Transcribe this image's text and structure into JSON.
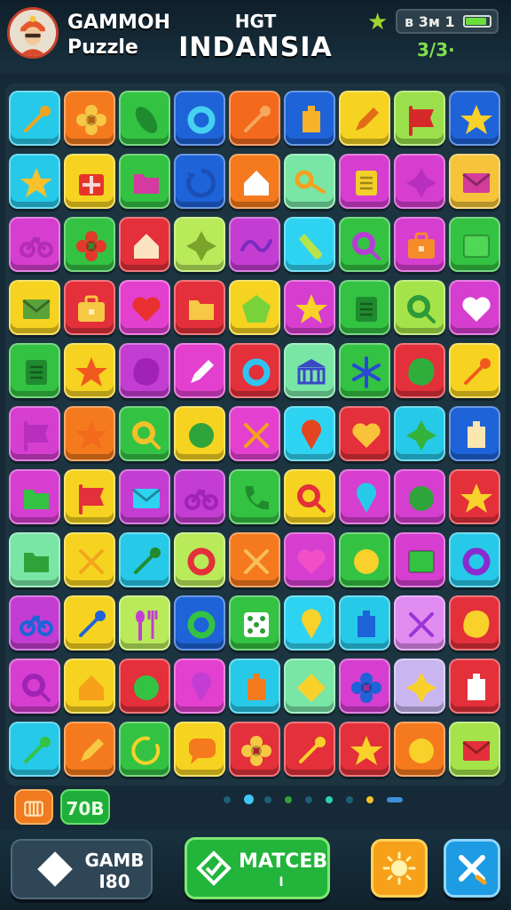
{
  "header": {
    "app_title_line1": "GAMMOH",
    "app_title_line2": "Puzzle",
    "level_label": "HGT",
    "level_name": "INDANSIA",
    "status_text": "ʙ 3ᴍ 1",
    "battery_level": 0.9,
    "score": "3/3·",
    "star_icon": "star-icon"
  },
  "board": {
    "rows": 11,
    "cols": 9,
    "tiles": [
      [
        "#27c9e8",
        "wrench",
        "#f2a51c"
      ],
      [
        "#f47a1d",
        "flower",
        "#f7c843"
      ],
      [
        "#34c243",
        "pickle",
        "#1f8b2e"
      ],
      [
        "#1e63d8",
        "ring",
        "#45d1f0"
      ],
      [
        "#f36a1c",
        "wrench",
        "#f5a75d"
      ],
      [
        "#1e63d8",
        "tag",
        "#f7b22a"
      ],
      [
        "#f6d320",
        "pencil",
        "#e36c18"
      ],
      [
        "#9be04c",
        "flag",
        "#d62a2a"
      ],
      [
        "#1e63d8",
        "star",
        "#f8d12a"
      ],
      [
        "#27c9e8",
        "star",
        "#f7c12b"
      ],
      [
        "#f6d320",
        "gift",
        "#e6342b"
      ],
      [
        "#34c243",
        "folder",
        "#d43aa0"
      ],
      [
        "#1e63d8",
        "cycle",
        "#1b4fb6"
      ],
      [
        "#f47a1d",
        "house",
        "#ffffff"
      ],
      [
        "#79e6a6",
        "key",
        "#f3a11f"
      ],
      [
        "#d63ed0",
        "list",
        "#f3cf2a"
      ],
      [
        "#d63ed0",
        "star4",
        "#b82fc0"
      ],
      [
        "#f6c43a",
        "envelope",
        "#d33c9b"
      ],
      [
        "#d63ed0",
        "bike",
        "#b22db4"
      ],
      [
        "#34c243",
        "flower",
        "#e13a2a"
      ],
      [
        "#e3303a",
        "house",
        "#fce4c2"
      ],
      [
        "#b8ea5a",
        "star4",
        "#7aa42a"
      ],
      [
        "#c43dd2",
        "wave",
        "#7a2bc0"
      ],
      [
        "#2fd3f2",
        "drop",
        "#b9e34a"
      ],
      [
        "#34c243",
        "search",
        "#b73bd6"
      ],
      [
        "#d63ed0",
        "case",
        "#f58c2a"
      ],
      [
        "#34c243",
        "rect",
        "#4fd755"
      ],
      [
        "#f6d320",
        "envelope",
        "#5aa33a"
      ],
      [
        "#e3303a",
        "case",
        "#f7c843"
      ],
      [
        "#e340d0",
        "heart",
        "#e83030"
      ],
      [
        "#e3303a",
        "folder",
        "#f7c843"
      ],
      [
        "#f6d320",
        "pentagon",
        "#7ad33a"
      ],
      [
        "#d63ed0",
        "star",
        "#f8d12a"
      ],
      [
        "#34c243",
        "list",
        "#1f8b2e"
      ],
      [
        "#a5e34a",
        "search",
        "#2f9a39"
      ],
      [
        "#d63ed0",
        "heart",
        "#ffffff"
      ],
      [
        "#34c243",
        "list",
        "#1f8b2e"
      ],
      [
        "#f6d320",
        "star",
        "#f05a1f"
      ],
      [
        "#c43dd2",
        "blob",
        "#a023b5"
      ],
      [
        "#e340d0",
        "pencil",
        "#ffffff"
      ],
      [
        "#e3303a",
        "ring",
        "#2fc3f0"
      ],
      [
        "#79e6a6",
        "bank",
        "#3a48c8"
      ],
      [
        "#34c243",
        "asterisk",
        "#2a48d6"
      ],
      [
        "#e3303a",
        "blob",
        "#2fae3c"
      ],
      [
        "#f6d320",
        "wrench",
        "#f05a1f"
      ],
      [
        "#d63ed0",
        "flag",
        "#b82fc0"
      ],
      [
        "#f47a1d",
        "star",
        "#f36a1c"
      ],
      [
        "#34c243",
        "search",
        "#f2c12a"
      ],
      [
        "#f6d320",
        "circle",
        "#2ea43a"
      ],
      [
        "#e340d0",
        "cross",
        "#f5a21c"
      ],
      [
        "#2fd3f2",
        "pin",
        "#e3451f"
      ],
      [
        "#e3303a",
        "heart",
        "#f7c33a"
      ],
      [
        "#27c9e8",
        "star4",
        "#34b33b"
      ],
      [
        "#1e63d8",
        "tag",
        "#fbe6b0"
      ],
      [
        "#d63ed0",
        "folder",
        "#34c243"
      ],
      [
        "#f6d320",
        "flag",
        "#e3303a"
      ],
      [
        "#c43dd2",
        "envelope",
        "#2fd3f2"
      ],
      [
        "#c43dd2",
        "bike",
        "#a023b5"
      ],
      [
        "#34c243",
        "phone",
        "#1f8b2e"
      ],
      [
        "#f6d320",
        "search",
        "#e3303a"
      ],
      [
        "#d63ed0",
        "pin",
        "#27c9e8"
      ],
      [
        "#d63ed0",
        "circle",
        "#2ea43a"
      ],
      [
        "#e3303a",
        "star",
        "#f8d12a"
      ],
      [
        "#79e6a6",
        "folder",
        "#2fa33a"
      ],
      [
        "#f6d320",
        "cross",
        "#f2a51c"
      ],
      [
        "#27c9e8",
        "wrench",
        "#1f8b2e"
      ],
      [
        "#b8ea5a",
        "ring",
        "#e3303a"
      ],
      [
        "#f47a1d",
        "cross",
        "#f9c05a"
      ],
      [
        "#d63ed0",
        "heart",
        "#f04fc8"
      ],
      [
        "#34c243",
        "circle",
        "#f8d12a"
      ],
      [
        "#d63ed0",
        "rect",
        "#34c243"
      ],
      [
        "#27c9e8",
        "ring",
        "#8a2bd0"
      ],
      [
        "#c43dd2",
        "bike",
        "#1e63d8"
      ],
      [
        "#f6d320",
        "wrench",
        "#1e63d8"
      ],
      [
        "#b8ea5a",
        "spoon",
        "#c43dd2"
      ],
      [
        "#1e63d8",
        "ring",
        "#34c243"
      ],
      [
        "#34c243",
        "dice",
        "#ffffff"
      ],
      [
        "#2fd3f2",
        "pin",
        "#f8d12a"
      ],
      [
        "#27c9e8",
        "tag",
        "#1e63d8"
      ],
      [
        "#e18cf0",
        "cross",
        "#9d34d8"
      ],
      [
        "#e3303a",
        "blob",
        "#f8d12a"
      ],
      [
        "#d63ed0",
        "search",
        "#a023b5"
      ],
      [
        "#f6d320",
        "house",
        "#f7a11a"
      ],
      [
        "#e3303a",
        "circle",
        "#34c243"
      ],
      [
        "#e340d0",
        "pin",
        "#c43dd2"
      ],
      [
        "#27c9e8",
        "tag",
        "#f47a1d"
      ],
      [
        "#79e6a6",
        "diamond",
        "#f8d12a"
      ],
      [
        "#d63ed0",
        "flower",
        "#1e63d8"
      ],
      [
        "#c9b6f0",
        "star4",
        "#f8d12a"
      ],
      [
        "#e3303a",
        "tag",
        "#ffffff"
      ],
      [
        "#27c9e8",
        "wrench",
        "#34c243"
      ],
      [
        "#f47a1d",
        "pencil",
        "#f7c843"
      ],
      [
        "#34c243",
        "arc",
        "#f8d12a"
      ],
      [
        "#f6d320",
        "bubble",
        "#f47a1d"
      ],
      [
        "#e3303a",
        "flower",
        "#f7c843"
      ],
      [
        "#e3303a",
        "wrench",
        "#f8d12a"
      ],
      [
        "#e3303a",
        "star",
        "#f8d12a"
      ],
      [
        "#f47a1d",
        "circle",
        "#f8d12a"
      ],
      [
        "#a5e34a",
        "envelope",
        "#e3303a"
      ]
    ]
  },
  "footer_chips": {
    "box_icon": "crate-icon",
    "count": "70B"
  },
  "pager_dots": {
    "count": 9,
    "active_index": 1,
    "colors": [
      "#1e5f75",
      "#3fc6f2",
      "#1e5f75",
      "#2fa33a",
      "#1e5f75",
      "#2fd3b2",
      "#1e5f75",
      "#f2c12a",
      "#3f8fd8"
    ]
  },
  "bottom_bar": {
    "game_button_line1": "GAMB",
    "game_button_line2": "I80",
    "match_button_label": "MATCEB",
    "match_button_sub": "I",
    "sun_icon": "sun-icon",
    "close_icon": "close-icon"
  }
}
